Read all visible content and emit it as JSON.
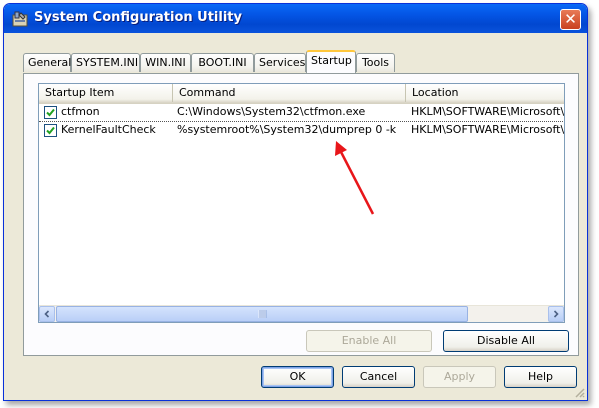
{
  "window": {
    "title": "System Configuration Utility",
    "close_glyph": "✕"
  },
  "tabs": [
    "General",
    "SYSTEM.INI",
    "WIN.INI",
    "BOOT.INI",
    "Services",
    "Startup",
    "Tools"
  ],
  "active_tab": "Startup",
  "list": {
    "columns": [
      "Startup Item",
      "Command",
      "Location"
    ],
    "rows": [
      {
        "checked": true,
        "item": "ctfmon",
        "command": "C:\\Windows\\System32\\ctfmon.exe",
        "location": "HKLM\\SOFTWARE\\Microsoft\\Wir"
      },
      {
        "checked": true,
        "item": "KernelFaultCheck",
        "command": "%systemroot%\\System32\\dumprep 0 -k",
        "location": "HKLM\\SOFTWARE\\Microsoft\\Wir"
      }
    ]
  },
  "panel_buttons": {
    "enable_all": "Enable All",
    "disable_all": "Disable All"
  },
  "dialog_buttons": {
    "ok": "OK",
    "cancel": "Cancel",
    "apply": "Apply",
    "help": "Help"
  },
  "colors": {
    "annotation_arrow": "#e8161a",
    "title_bar": "#0a5fe8",
    "active_tab_accent": "#ffc73c"
  },
  "icons": {
    "app": "gear-toolbox-icon",
    "checkbox": "check-icon",
    "scroll_left": "arrow-left-icon",
    "scroll_right": "arrow-right-icon"
  }
}
